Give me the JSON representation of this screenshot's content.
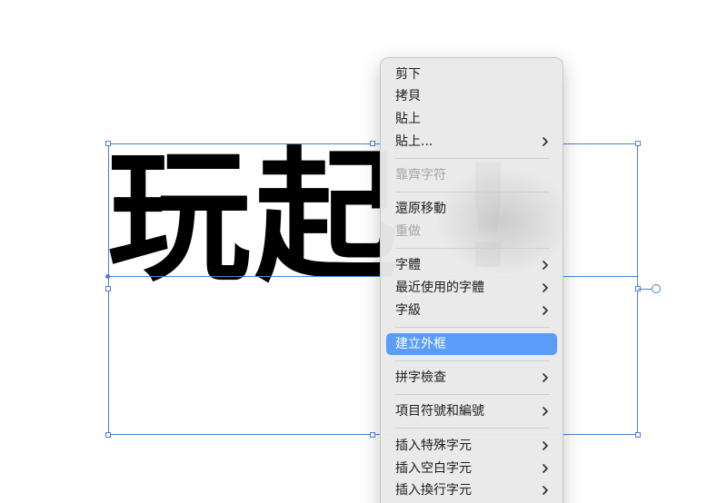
{
  "canvas": {
    "headline_text": "玩起  !"
  },
  "context_menu": {
    "items": [
      {
        "label": "剪下",
        "enabled": true,
        "submenu": false
      },
      {
        "label": "拷貝",
        "enabled": true,
        "submenu": false
      },
      {
        "label": "貼上",
        "enabled": true,
        "submenu": false
      },
      {
        "label": "貼上...",
        "enabled": true,
        "submenu": true
      },
      {
        "label": "靠齊字符",
        "enabled": false,
        "submenu": false
      },
      {
        "label": "還原移動",
        "enabled": true,
        "submenu": false
      },
      {
        "label": "重做",
        "enabled": false,
        "submenu": false
      },
      {
        "label": "字體",
        "enabled": true,
        "submenu": true
      },
      {
        "label": "最近使用的字體",
        "enabled": true,
        "submenu": true
      },
      {
        "label": "字級",
        "enabled": true,
        "submenu": true
      },
      {
        "label": "建立外框",
        "enabled": true,
        "submenu": false,
        "highlighted": true
      },
      {
        "label": "拼字檢查",
        "enabled": true,
        "submenu": true
      },
      {
        "label": "項目符號和編號",
        "enabled": true,
        "submenu": true
      },
      {
        "label": "插入特殊字元",
        "enabled": true,
        "submenu": true
      },
      {
        "label": "插入空白字元",
        "enabled": true,
        "submenu": true
      },
      {
        "label": "插入換行字元",
        "enabled": true,
        "submenu": true
      }
    ]
  },
  "colors": {
    "selection": "#4f7fd6",
    "menu_highlight": "#5a9cf8",
    "menu_background": "#e9e9e9",
    "disabled_text": "#a5a5a5"
  }
}
